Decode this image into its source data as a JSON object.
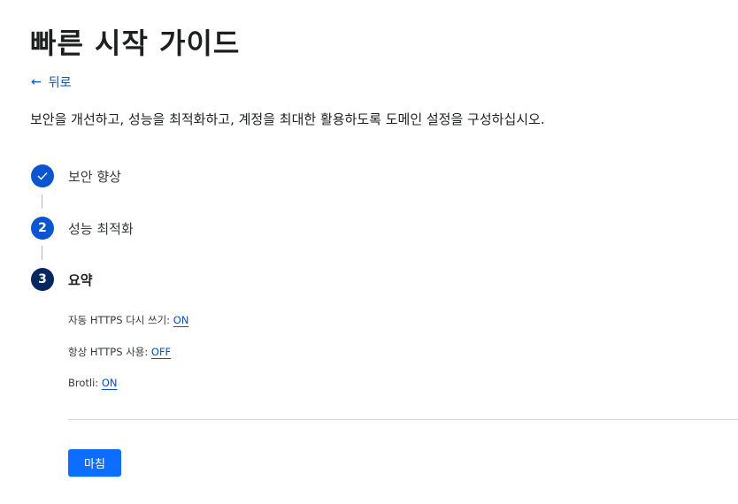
{
  "page": {
    "title": "빠른 시작 가이드",
    "back_label": "뒤로",
    "description": "보안을 개선하고, 성능을 최적화하고, 계정을 최대한 활용하도록 도메인 설정을 구성하십시오."
  },
  "steps": [
    {
      "status": "completed",
      "badge": "",
      "label": "보안 향상"
    },
    {
      "status": "pending",
      "badge": "2",
      "label": "성능 최적화"
    },
    {
      "status": "current",
      "badge": "3",
      "label": "요약"
    }
  ],
  "summary": [
    {
      "label": "자동 HTTPS 다시 쓰기:",
      "value": "ON"
    },
    {
      "label": "항상 HTTPS 사용:",
      "value": "OFF"
    },
    {
      "label": "Brotli:",
      "value": "ON"
    }
  ],
  "actions": {
    "finish_label": "마침"
  },
  "colors": {
    "link": "#0051c3",
    "step_active": "#0b56d0",
    "step_current": "#07285f",
    "primary_button": "#0d6efd"
  }
}
